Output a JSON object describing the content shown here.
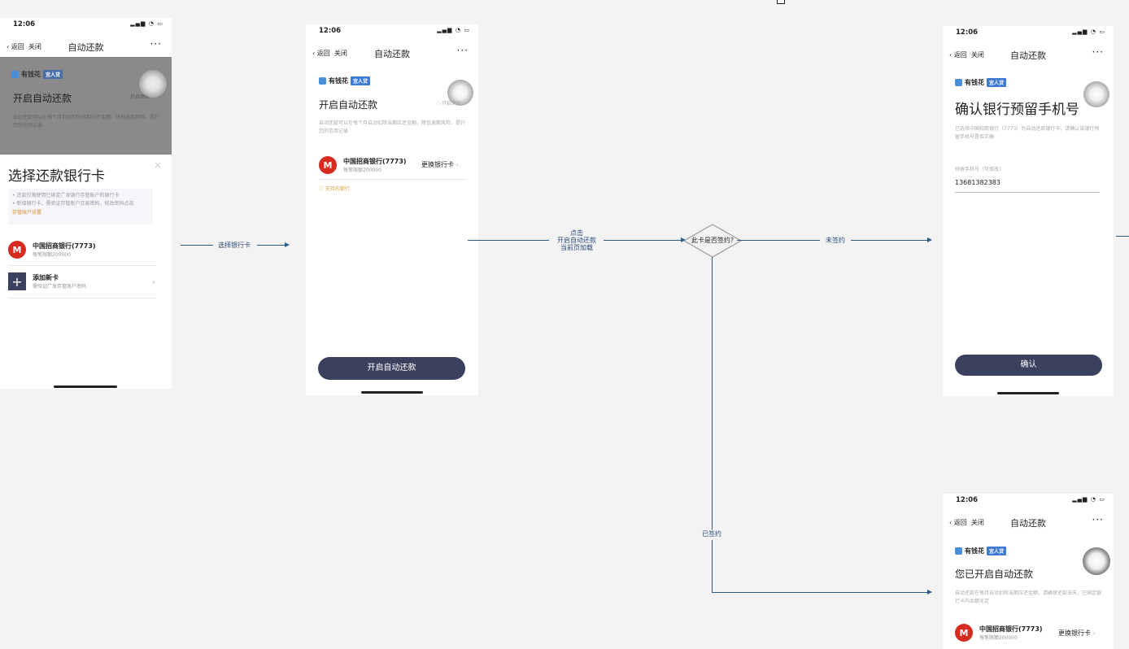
{
  "status_time": "12:06",
  "nav": {
    "back": "返回",
    "close": "关闭",
    "title": "自动还款",
    "more": "···"
  },
  "brand": {
    "name": "有钱花",
    "tag": "宜人贷"
  },
  "screen1": {
    "heading": "开启自动还款",
    "toggle_hint": "开启须知",
    "desc": "自动还款可以在每个月自动扣除当期应还金额，降低逾期风险，提升您的信用记录",
    "sheet_title": "选择还款银行卡",
    "notice_1": "• 还款仅限使用已绑定广发银行存管账户的银行卡",
    "notice_2": "• 新增银行卡，需验证存管账户交易密码，修改密码点击",
    "notice_link": "存管账户设置",
    "bank_name": "中国招商银行(7773)",
    "bank_sub": "每笔限额200000",
    "add_card": "添加新卡",
    "add_card_sub": "需验证广发存管账户密码"
  },
  "screen2": {
    "heading": "开启自动还款",
    "toggle_hint": "开启须知",
    "desc": "自动还款可以在每个月自动扣除当期应还金额，降低逾期风险，提升您的信用记录",
    "bank_name": "中国招商银行(7773)",
    "bank_sub": "每笔限额200000",
    "change_card": "更换银行卡",
    "supported": "支持的银行",
    "button": "开启自动还款"
  },
  "screen3": {
    "heading": "确认银行预留手机号",
    "desc": "已选择中国招商银行（7773）为自动还款银行卡，请确认该银行预留手机号是否正确",
    "field_label": "预留手机号（可修改）",
    "field_value": "13681382383",
    "button": "确认"
  },
  "screen4": {
    "heading": "您已开启自动还款",
    "desc": "自动还款在每月自动扣除当期应还金额，请确保还款当天，已绑定银行卡内余额充足",
    "bank_name": "中国招商银行(7773)",
    "bank_sub": "每笔限额200000",
    "change_card": "更换银行卡"
  },
  "flow": {
    "select_card": "选择银行卡",
    "click_label": "点击\n开启自动还款\n当前页加载",
    "decision": "此卡是否签约?",
    "not_signed": "未签约",
    "signed": "已签约"
  },
  "colors": {
    "primary_button": "#3b405f",
    "flow_line": "#2b5b8a",
    "bank_red": "#d72b1f",
    "brand_blue": "#3e7bd6"
  }
}
